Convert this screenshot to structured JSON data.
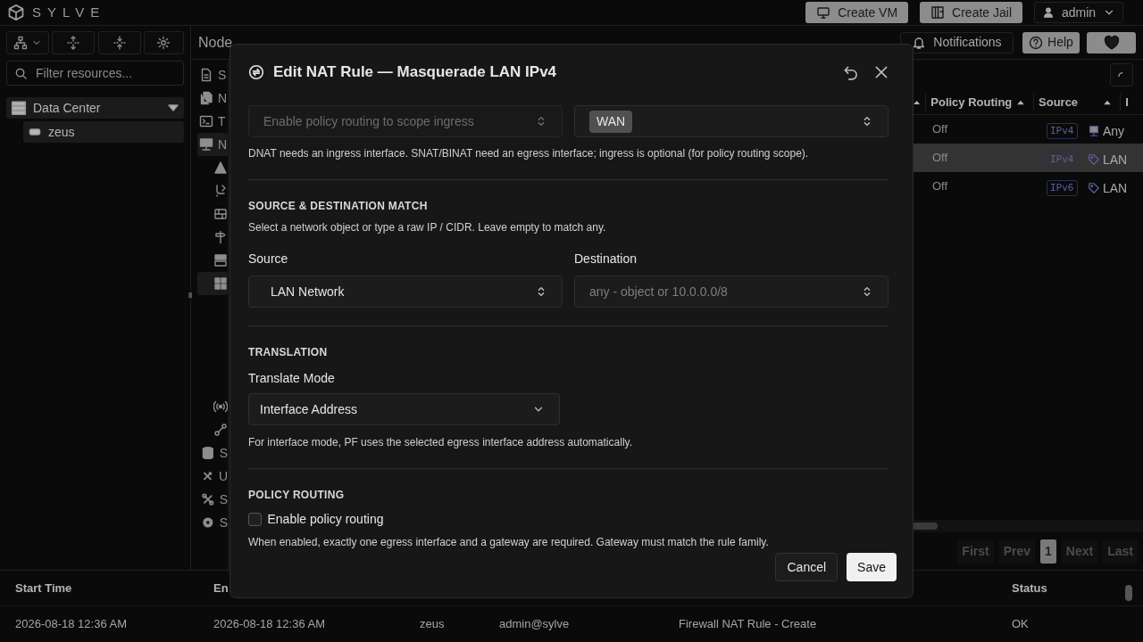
{
  "app": {
    "logo": "SYLVE"
  },
  "top_actions": [
    {
      "label": "Create VM"
    },
    {
      "label": "Create Jail"
    }
  ],
  "user_menu": {
    "label": "admin"
  },
  "sidebar": {
    "search": {
      "placeholder": "Filter resources..."
    },
    "tree": [
      {
        "label": "Data Center",
        "expanded": true,
        "children": [
          {
            "label": "zeus"
          }
        ]
      }
    ]
  },
  "breadcrumb": "Node",
  "header_buttons": [
    {
      "label": "Notifications"
    },
    {
      "label": "Help"
    }
  ],
  "node_nav": [
    {
      "label": "S",
      "selected": false
    },
    {
      "label": "N",
      "selected": false
    },
    {
      "label": "T",
      "selected": false
    },
    {
      "label": "N",
      "selected": true
    },
    {
      "label": "S",
      "selected": false
    },
    {
      "label": "U",
      "selected": false
    },
    {
      "label": "S",
      "selected": false
    },
    {
      "label": "S",
      "selected": false
    }
  ],
  "table": {
    "columns": [
      {
        "label": "Policy Routing"
      },
      {
        "label": "Source"
      },
      {
        "label": "I"
      }
    ],
    "rows": [
      {
        "policy_routing": "Off",
        "family": "IPv4",
        "source": "Any",
        "kind": "any",
        "selected": false
      },
      {
        "policy_routing": "Off",
        "family": "IPv4",
        "source": "LAN",
        "kind": "object",
        "selected": true
      },
      {
        "policy_routing": "Off",
        "family": "IPv6",
        "source": "LAN",
        "kind": "object",
        "selected": false
      }
    ]
  },
  "pagination": [
    {
      "label": "First",
      "disabled": true,
      "selected": false
    },
    {
      "label": "Prev",
      "disabled": true,
      "selected": false
    },
    {
      "label": "1",
      "disabled": false,
      "selected": true
    },
    {
      "label": "Next",
      "disabled": true,
      "selected": false
    },
    {
      "label": "Last",
      "disabled": true,
      "selected": false
    }
  ],
  "log": {
    "columns": [
      {
        "label": "Start Time"
      },
      {
        "label": "En"
      },
      {},
      {},
      {},
      {
        "label": "Status"
      }
    ],
    "rows": [
      {
        "cells": [
          "2026-08-18 12:36 AM",
          "2026-08-18 12:36 AM",
          "zeus",
          "admin@sylve",
          "Firewall NAT Rule - Create",
          "OK"
        ]
      }
    ]
  },
  "dialog": {
    "title": "Edit NAT Rule — Masquerade LAN IPv4",
    "ingress": {
      "placeholder": "Enable policy routing to scope ingress",
      "disabled": true
    },
    "egress": {
      "chips": [
        "WAN"
      ]
    },
    "interface_help": "DNAT needs an ingress interface. SNAT/BINAT need an egress interface; ingress is optional (for policy routing scope).",
    "match": {
      "heading": "SOURCE & DESTINATION MATCH",
      "description": "Select a network object or type a raw IP / CIDR. Leave empty to match any.",
      "source": {
        "label": "Source",
        "value": "LAN Network"
      },
      "destination": {
        "label": "Destination",
        "placeholder": "any - object or 10.0.0.0/8"
      }
    },
    "translation": {
      "heading": "TRANSLATION",
      "mode_label": "Translate Mode",
      "mode": "Interface Address",
      "help": "For interface mode, PF uses the selected egress interface address automatically."
    },
    "policy_routing": {
      "heading": "POLICY ROUTING",
      "checkbox": {
        "label": "Enable policy routing",
        "checked": false
      },
      "help": "When enabled, exactly one egress interface and a gateway are required. Gateway must match the rule family."
    },
    "buttons": [
      {
        "label": "Cancel",
        "kind": "secondary"
      },
      {
        "label": "Save",
        "kind": "primary"
      }
    ]
  }
}
